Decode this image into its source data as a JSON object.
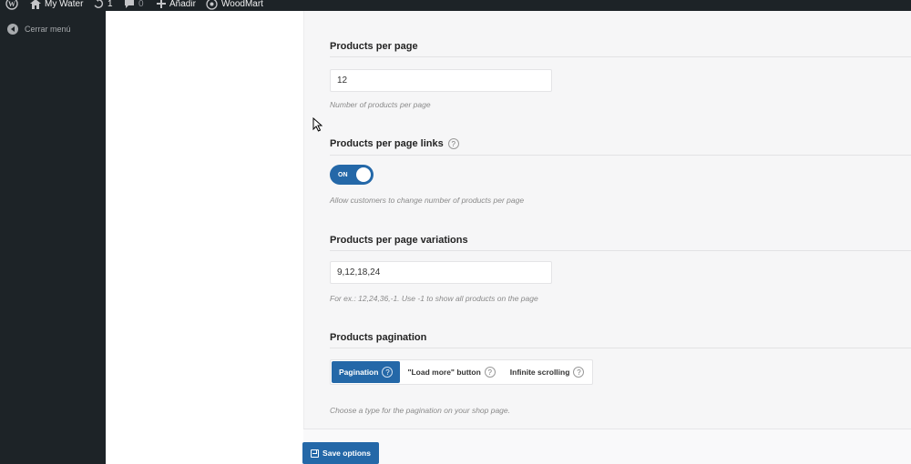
{
  "adminbar": {
    "site_name": "My Water",
    "updates_count": "1",
    "comments_count": "0",
    "add_label": "Añadir",
    "theme_label": "WoodMart"
  },
  "sidebar": {
    "collapse_label": "Cerrar menú"
  },
  "settings": {
    "products_per_page": {
      "title": "Products per page",
      "value": "12",
      "description": "Number of products per page"
    },
    "per_page_links": {
      "title": "Products per page links",
      "toggle_label": "ON",
      "toggle_state": true,
      "description": "Allow customers to change number of products per page"
    },
    "per_page_variations": {
      "title": "Products per page variations",
      "value": "9,12,18,24",
      "description": "For ex.: 12,24,36,-1. Use -1 to show all products on the page"
    },
    "pagination": {
      "title": "Products pagination",
      "options": [
        "Pagination",
        "\"Load more\" button",
        "Infinite scrolling"
      ],
      "selected": "Pagination",
      "description": "Choose a type for the pagination on your shop page."
    }
  },
  "footer": {
    "save_label": "Save options"
  },
  "colors": {
    "accent": "#2468a8",
    "adminbar_bg": "#1d2327",
    "panel_bg": "#f6f6f7"
  }
}
